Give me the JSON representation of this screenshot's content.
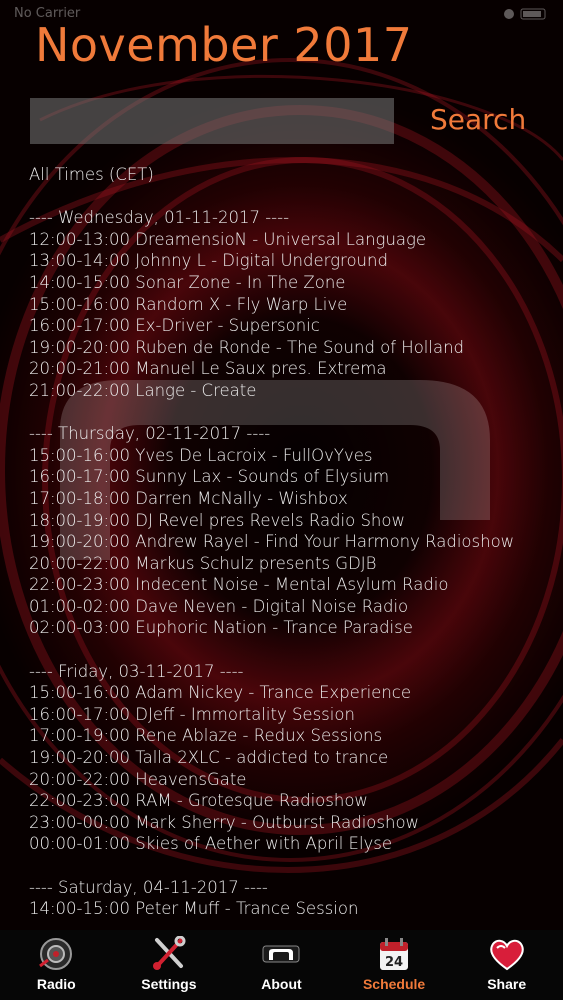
{
  "status_bar": {
    "carrier": "No Carrier"
  },
  "title": "November 2017",
  "search": {
    "value": "",
    "placeholder": "",
    "button_label": "Search"
  },
  "timezone_note": "All Times (CET)",
  "days": [
    {
      "header": "---- Wednesday, 01-11-2017 ----",
      "shows": [
        "12:00-13:00 DreamensioN - Universal Language",
        "13:00-14:00 Johnny L - Digital Underground",
        "14:00-15:00 Sonar Zone - In The Zone",
        "15:00-16:00 Random X - Fly Warp Live",
        "16:00-17:00 Ex-Driver - Supersonic",
        "19:00-20:00 Ruben de Ronde - The Sound of Holland",
        "20:00-21:00 Manuel Le Saux pres. Extrema",
        "21:00-22:00 Lange - Create"
      ]
    },
    {
      "header": "---- Thursday, 02-11-2017 ----",
      "shows": [
        "15:00-16:00 Yves De Lacroix - FullOvYves",
        "16:00-17:00 Sunny Lax - Sounds of Elysium",
        "17:00-18:00 Darren McNally - Wishbox",
        "18:00-19:00 DJ Revel pres Revels Radio Show",
        "19:00-20:00 Andrew Rayel - Find Your Harmony Radioshow",
        "20:00-22:00 Markus Schulz presents GDJB",
        "22:00-23:00 Indecent Noise - Mental Asylum Radio",
        "01:00-02:00 Dave Neven - Digital Noise Radio",
        "02:00-03:00 Euphoric Nation - Trance Paradise"
      ]
    },
    {
      "header": "---- Friday, 03-11-2017 ----",
      "shows": [
        "15:00-16:00 Adam Nickey - Trance Experience",
        "16:00-17:00 DJeff - Immortality Session",
        "17:00-19:00 Rene Ablaze - Redux Sessions",
        "19:00-20:00 Talla 2XLC - addicted to trance",
        "20:00-22:00 HeavensGate",
        "22:00-23:00 RAM - Grotesque Radioshow",
        "23:00-00:00 Mark Sherry - Outburst Radioshow",
        "00:00-01:00 Skies of Aether with April Elyse"
      ]
    },
    {
      "header": "---- Saturday, 04-11-2017 ----",
      "shows": [
        "14:00-15:00 Peter Muff - Trance Session"
      ]
    }
  ],
  "tabbar": {
    "radio": "Radio",
    "settings": "Settings",
    "about": "About",
    "schedule": "Schedule",
    "schedule_icon_day": "24",
    "share": "Share"
  },
  "colors": {
    "accent": "#f07a3a",
    "tab_bg": "#060606",
    "search_bg": "#6b6b6b"
  }
}
